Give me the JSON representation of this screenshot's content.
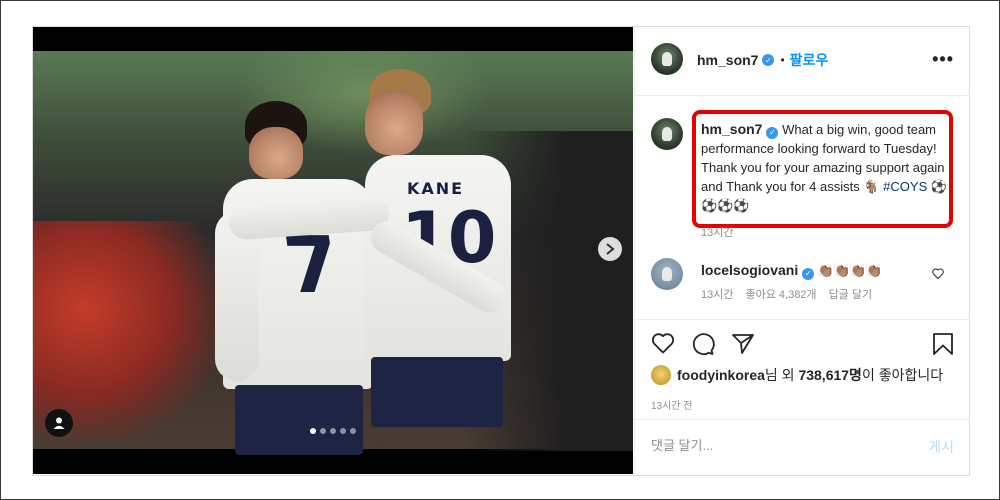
{
  "post": {
    "author": {
      "username": "hm_son7",
      "verified": true,
      "follow_label": "팔로우",
      "separator": "•"
    },
    "more_icon": "more-horizontal-icon",
    "media": {
      "players": [
        {
          "number": "7",
          "name": ""
        },
        {
          "number": "10",
          "name": "KANE"
        }
      ],
      "carousel": {
        "count": 5,
        "active_index": 0
      },
      "next_icon": "chevron-right-icon",
      "tag_icon": "user-tag-icon"
    },
    "caption": {
      "username": "hm_son7",
      "text": "What a big win, good team performance looking forward to Tuesday! Thank you for your amazing support again and Thank you for 4 assists 🐐",
      "hashtag": "#COYS",
      "emoji_tail": "⚽⚽⚽⚽",
      "time": "13시간",
      "highlight_color": "#e60000"
    },
    "comments": [
      {
        "username": "locelsogiovani",
        "verified": true,
        "text": "👏🏽👏🏽👏🏽👏🏽",
        "time": "13시간",
        "likes": "좋아요 4,382개",
        "reply_label": "답글 달기"
      }
    ],
    "actions": {
      "like_icon": "heart-icon",
      "comment_icon": "comment-icon",
      "share_icon": "send-icon",
      "save_icon": "bookmark-icon"
    },
    "likes": {
      "liker": "foodyinkorea",
      "suffix_1": "님 외 ",
      "count": "738,617명",
      "suffix_2": "이 좋아합니다"
    },
    "post_time": "13시간 전",
    "comment_box": {
      "placeholder": "댓글 달기...",
      "submit_label": "게시"
    },
    "colors": {
      "accent": "#0095f6",
      "verified": "#3897f0",
      "hashtag": "#00376b",
      "muted": "#8e8e8e"
    }
  }
}
